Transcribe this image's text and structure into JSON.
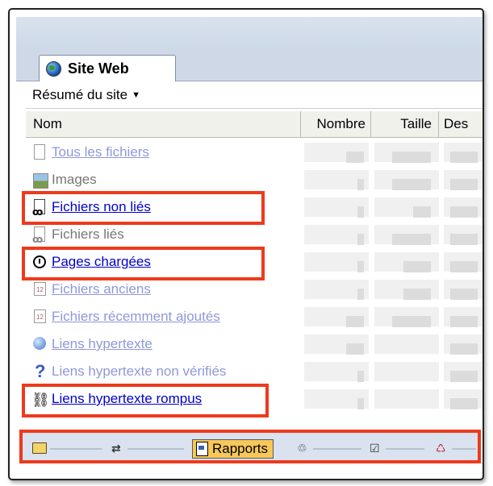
{
  "tab": {
    "label": "Site Web",
    "icon": "globe-icon"
  },
  "summary_menu": {
    "label": "Résumé du site"
  },
  "columns": {
    "nom": "Nom",
    "nombre": "Nombre",
    "taille": "Taille",
    "desc": "Des"
  },
  "rows": [
    {
      "label": "Tous les fichiers",
      "icon": "document-icon",
      "state": "link-dim"
    },
    {
      "label": "Images",
      "icon": "image-icon",
      "state": "plain"
    },
    {
      "label": "Fichiers non liés",
      "icon": "unlinked-file-icon",
      "state": "active"
    },
    {
      "label": "Fichiers liés",
      "icon": "linked-file-icon",
      "state": "plain"
    },
    {
      "label": "Pages chargées",
      "icon": "clock-icon",
      "state": "active"
    },
    {
      "label": "Fichiers anciens",
      "icon": "calendar-icon",
      "state": "link-dim"
    },
    {
      "label": "Fichiers récemment ajoutés",
      "icon": "calendar-icon",
      "state": "link-dim"
    },
    {
      "label": "Liens hypertexte",
      "icon": "globe-link-icon",
      "state": "link-dim"
    },
    {
      "label": "Liens hypertexte non vérifiés",
      "icon": "question-icon",
      "state": "link-dim"
    },
    {
      "label": "Liens hypertexte rompus",
      "icon": "broken-link-icon",
      "state": "active"
    }
  ],
  "bottom_bar": {
    "rapports_label": "Rapports",
    "icons": [
      "folder-icon",
      "navigation-icon",
      "rapports-icon",
      "hyperlinks-icon",
      "tasks-icon",
      "recycle-icon"
    ]
  },
  "colors": {
    "highlight": "#ee3a1c",
    "link_active": "#0000cc",
    "link_dim": "#8f98d8",
    "rapports_bg": "#f7c75a"
  }
}
